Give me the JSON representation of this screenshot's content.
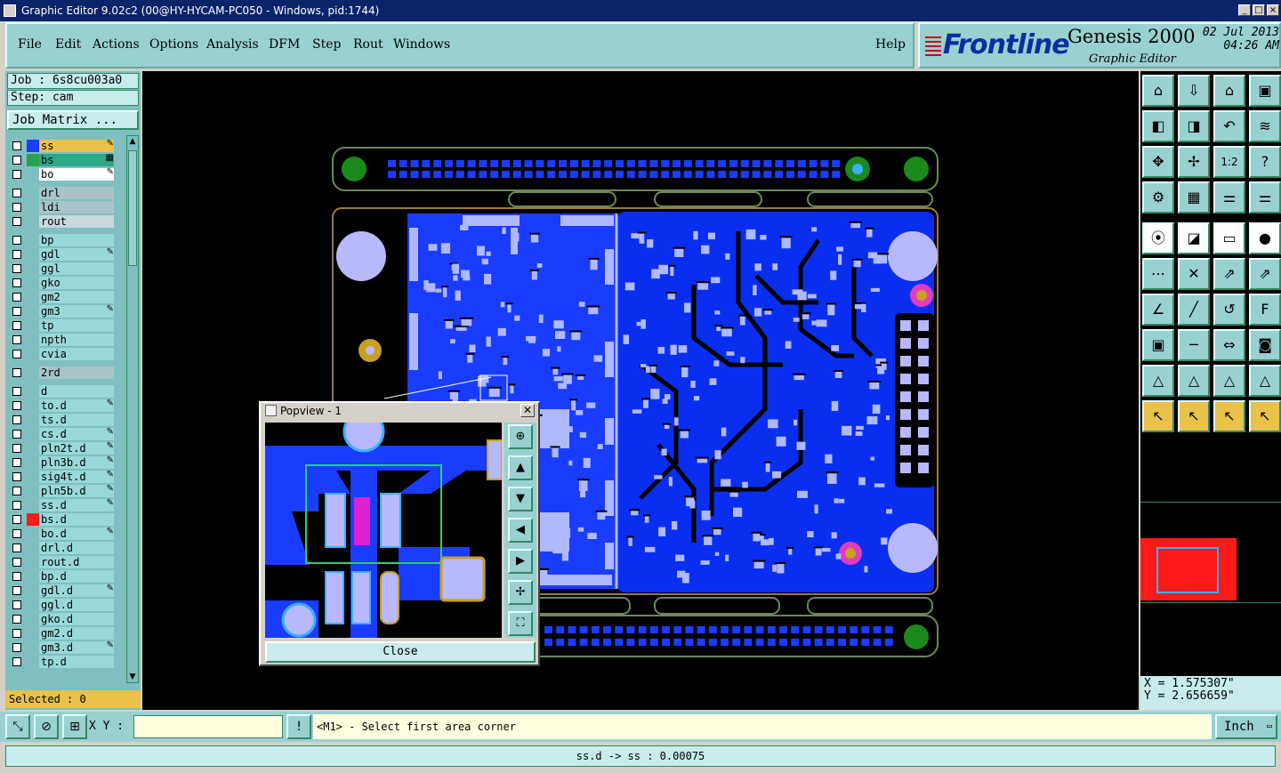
{
  "window": {
    "title": "Graphic Editor 9.02c2 (00@HY-HYCAM-PC050 - Windows, pid:1744)"
  },
  "menu": {
    "items": [
      "File",
      "Edit",
      "Actions",
      "Options",
      "Analysis",
      "DFM",
      "Step",
      "Rout",
      "Windows"
    ],
    "help": "Help"
  },
  "brand": {
    "logo": "Frontline",
    "product": "Genesis 2000",
    "subtitle": "Graphic Editor",
    "date": "02 Jul 2013",
    "time": "04:26 AM"
  },
  "job": {
    "job_line": "Job : 6s8cu003a0",
    "step_line": "Step: cam",
    "matrix_button": "Job Matrix ..."
  },
  "layers": [
    {
      "name": "ss",
      "bg": "#e8c24a",
      "swatch": "#1a3cff",
      "mark": "pen"
    },
    {
      "name": "bs",
      "bg": "#2aa88a",
      "swatch": "#2aa050",
      "mark": "grid"
    },
    {
      "name": "bo",
      "bg": "#ffffff",
      "swatch": "",
      "mark": "pen"
    },
    {
      "name": "drl",
      "bg": "#a8c4c8",
      "swatch": "",
      "mark": ""
    },
    {
      "name": "ldi",
      "bg": "#a8c4c8",
      "swatch": "",
      "mark": ""
    },
    {
      "name": "rout",
      "bg": "#c8d8dc",
      "swatch": "",
      "mark": ""
    },
    {
      "name": "bp",
      "bg": "#99d8d8",
      "swatch": "",
      "mark": ""
    },
    {
      "name": "gdl",
      "bg": "#99d8d8",
      "swatch": "",
      "mark": "pen"
    },
    {
      "name": "ggl",
      "bg": "#99d8d8",
      "swatch": "",
      "mark": ""
    },
    {
      "name": "gko",
      "bg": "#99d8d8",
      "swatch": "",
      "mark": ""
    },
    {
      "name": "gm2",
      "bg": "#99d8d8",
      "swatch": "",
      "mark": ""
    },
    {
      "name": "gm3",
      "bg": "#99d8d8",
      "swatch": "",
      "mark": "pen"
    },
    {
      "name": "tp",
      "bg": "#99d8d8",
      "swatch": "",
      "mark": ""
    },
    {
      "name": "npth",
      "bg": "#99d8d8",
      "swatch": "",
      "mark": ""
    },
    {
      "name": "cvia",
      "bg": "#99d8d8",
      "swatch": "",
      "mark": ""
    },
    {
      "name": "2rd",
      "bg": "#a8c4c8",
      "swatch": "",
      "mark": ""
    },
    {
      "name": "d",
      "bg": "#99d8d8",
      "swatch": "",
      "mark": ""
    },
    {
      "name": "to.d",
      "bg": "#99d8d8",
      "swatch": "",
      "mark": "pen"
    },
    {
      "name": "ts.d",
      "bg": "#99d8d8",
      "swatch": "",
      "mark": ""
    },
    {
      "name": "cs.d",
      "bg": "#99d8d8",
      "swatch": "",
      "mark": "pen"
    },
    {
      "name": "pln2t.d",
      "bg": "#99d8d8",
      "swatch": "",
      "mark": "pen"
    },
    {
      "name": "pln3b.d",
      "bg": "#99d8d8",
      "swatch": "",
      "mark": "pen"
    },
    {
      "name": "sig4t.d",
      "bg": "#99d8d8",
      "swatch": "",
      "mark": "pen"
    },
    {
      "name": "pln5b.d",
      "bg": "#99d8d8",
      "swatch": "",
      "mark": "pen"
    },
    {
      "name": "ss.d",
      "bg": "#99d8d8",
      "swatch": "",
      "mark": "pen"
    },
    {
      "name": "bs.d",
      "bg": "#99d8d8",
      "swatch": "#ff1a1a",
      "mark": ""
    },
    {
      "name": "bo.d",
      "bg": "#99d8d8",
      "swatch": "",
      "mark": "pen"
    },
    {
      "name": "drl.d",
      "bg": "#99d8d8",
      "swatch": "",
      "mark": ""
    },
    {
      "name": "rout.d",
      "bg": "#99d8d8",
      "swatch": "",
      "mark": ""
    },
    {
      "name": "bp.d",
      "bg": "#99d8d8",
      "swatch": "",
      "mark": ""
    },
    {
      "name": "gdl.d",
      "bg": "#99d8d8",
      "swatch": "",
      "mark": "pen"
    },
    {
      "name": "ggl.d",
      "bg": "#99d8d8",
      "swatch": "",
      "mark": ""
    },
    {
      "name": "gko.d",
      "bg": "#99d8d8",
      "swatch": "",
      "mark": ""
    },
    {
      "name": "gm2.d",
      "bg": "#99d8d8",
      "swatch": "",
      "mark": ""
    },
    {
      "name": "gm3.d",
      "bg": "#99d8d8",
      "swatch": "",
      "mark": "pen"
    },
    {
      "name": "tp.d",
      "bg": "#99d8d8",
      "swatch": "",
      "mark": ""
    }
  ],
  "selected": "Selected : 0",
  "coords": {
    "x": "X = 1.575307\"",
    "y": "Y = 2.656659\""
  },
  "bottom": {
    "xy_label": "X Y :",
    "xy_value": "",
    "prompt": "<M1> - Select first area corner",
    "unit": "Inch"
  },
  "status": "ss.d -> ss : 0.00075",
  "popview": {
    "title": "Popview - 1",
    "close_label": "Close"
  },
  "colors": {
    "accent": "#99d0d0",
    "board": "#0a2ef0",
    "pad": "#b0b8ff",
    "highlight": "#e8c24a"
  }
}
